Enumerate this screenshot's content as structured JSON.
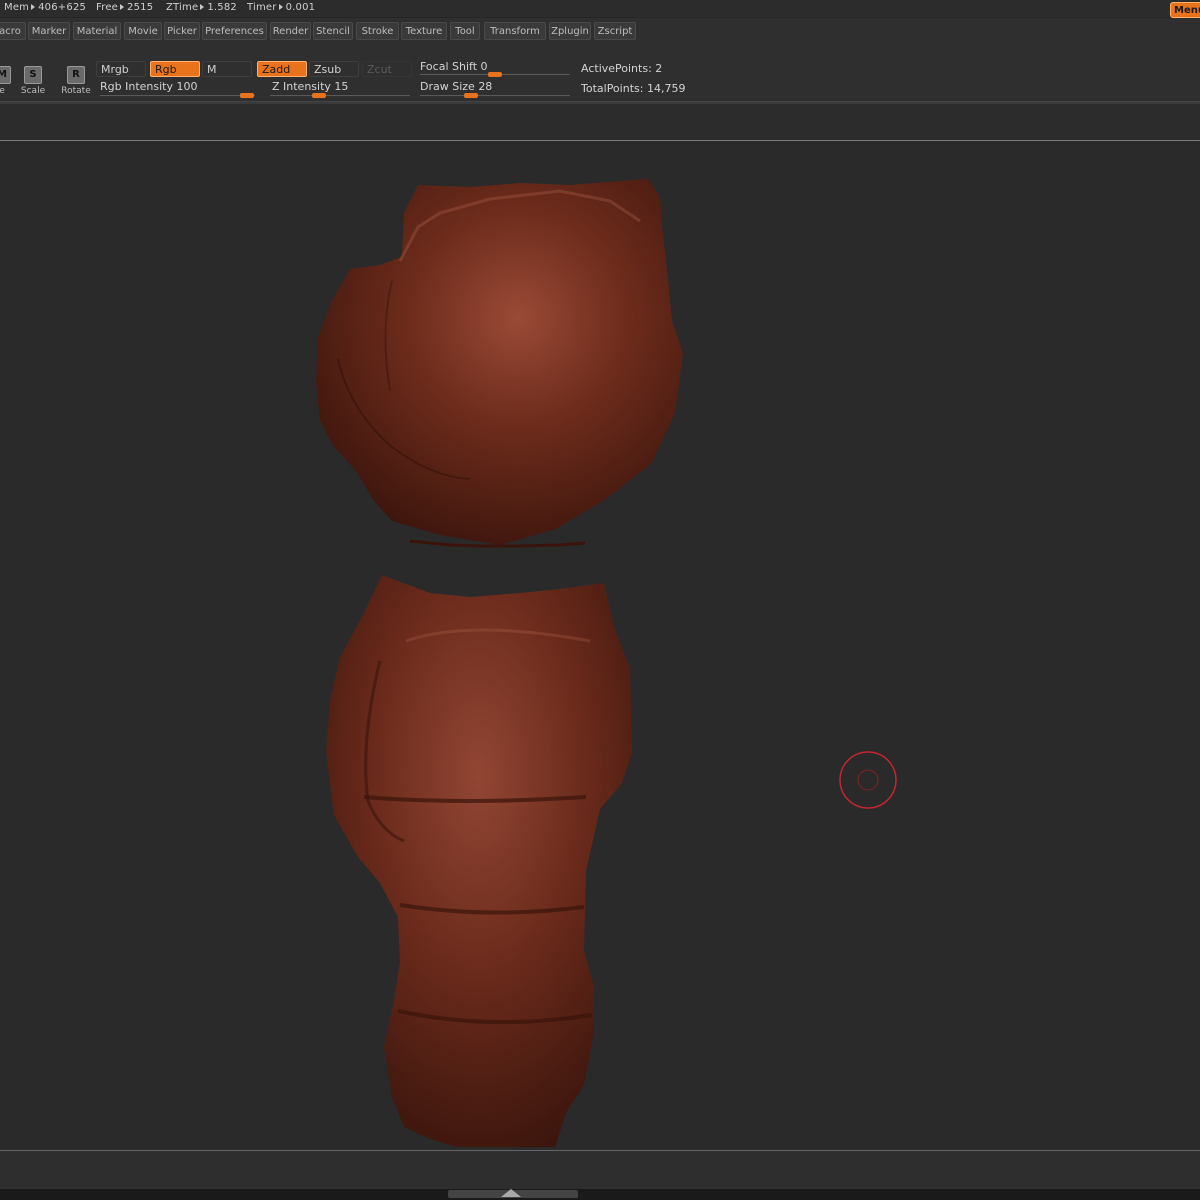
{
  "status": {
    "mem_label": "Mem",
    "mem_value": "406+625",
    "free_label": "Free",
    "free_value": "2515",
    "ztime_label": "ZTime",
    "ztime_value": "1.582",
    "timer_label": "Timer",
    "timer_value": "0.001",
    "menu_button": "Menu"
  },
  "menubar": {
    "items": [
      "acro",
      "Marker",
      "Material",
      "Movie",
      "Picker",
      "Preferences",
      "Render",
      "Stencil",
      "Stroke",
      "Texture",
      "Tool",
      "Transform",
      "Zplugin",
      "Zscript"
    ]
  },
  "toolbar": {
    "move_icon": "M",
    "move_label": "e",
    "scale_icon": "S",
    "scale_label": "Scale",
    "rotate_icon": "R",
    "rotate_label": "Rotate",
    "mrgb": "Mrgb",
    "rgb": "Rgb",
    "m": "M",
    "zadd": "Zadd",
    "zsub": "Zsub",
    "zcut": "Zcut",
    "rgb_intensity_label": "Rgb  Intensity",
    "rgb_intensity_value": "100",
    "z_intensity_label": "Z  Intensity",
    "z_intensity_value": "15",
    "focal_shift_label": "Focal  Shift",
    "focal_shift_value": "0",
    "draw_size_label": "Draw  Size",
    "draw_size_value": "28",
    "active_points_label": "ActivePoints:",
    "active_points_value": "2",
    "total_points_label": "TotalPoints:",
    "total_points_value": "14,759"
  },
  "colors": {
    "accent": "#e8731c",
    "model": "#6b2a1a",
    "cursor": "#c0272d"
  }
}
